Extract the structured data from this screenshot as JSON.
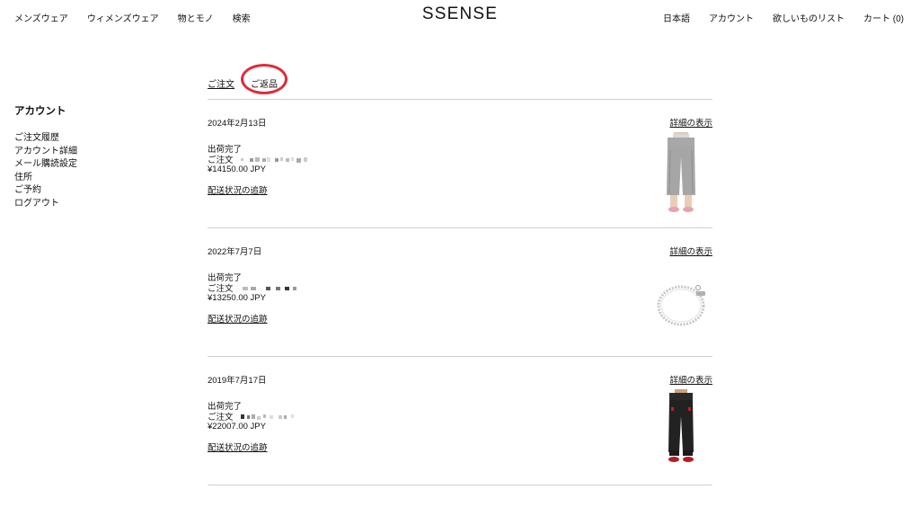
{
  "header": {
    "logo": "SSENSE",
    "nav_left": [
      "メンズウェア",
      "ウィメンズウェア",
      "物とモノ",
      "検索"
    ],
    "nav_right": [
      "日本語",
      "アカウント",
      "欲しいものリスト",
      "カート (0)"
    ]
  },
  "sidebar": {
    "title": "アカウント",
    "items": [
      "ご注文履歴",
      "アカウント詳細",
      "メール購読設定",
      "住所",
      "ご予約",
      "ログアウト"
    ]
  },
  "tabs": {
    "orders": "ご注文",
    "returns": "ご返品"
  },
  "orders": [
    {
      "date": "2024年2月13日",
      "details_label": "詳細の表示",
      "status": "出荷完了",
      "order_label": "ご注文",
      "price": "¥14150.00 JPY",
      "track_label": "配送状況の追跡",
      "product_icon": "grey-trousers"
    },
    {
      "date": "2022年7月7日",
      "details_label": "詳細の表示",
      "status": "出荷完了",
      "order_label": "ご注文",
      "price": "¥13250.00 JPY",
      "track_label": "配送状況の追跡",
      "product_icon": "silver-chain-bracelet"
    },
    {
      "date": "2019年7月17日",
      "details_label": "詳細の表示",
      "status": "出荷完了",
      "order_label": "ご注文",
      "price": "¥22007.00 JPY",
      "track_label": "配送状況の追跡",
      "product_icon": "black-track-pants"
    }
  ],
  "colors": {
    "highlight_ring": "#e22b3a",
    "divider": "#cfcfcf",
    "text": "#111111"
  }
}
